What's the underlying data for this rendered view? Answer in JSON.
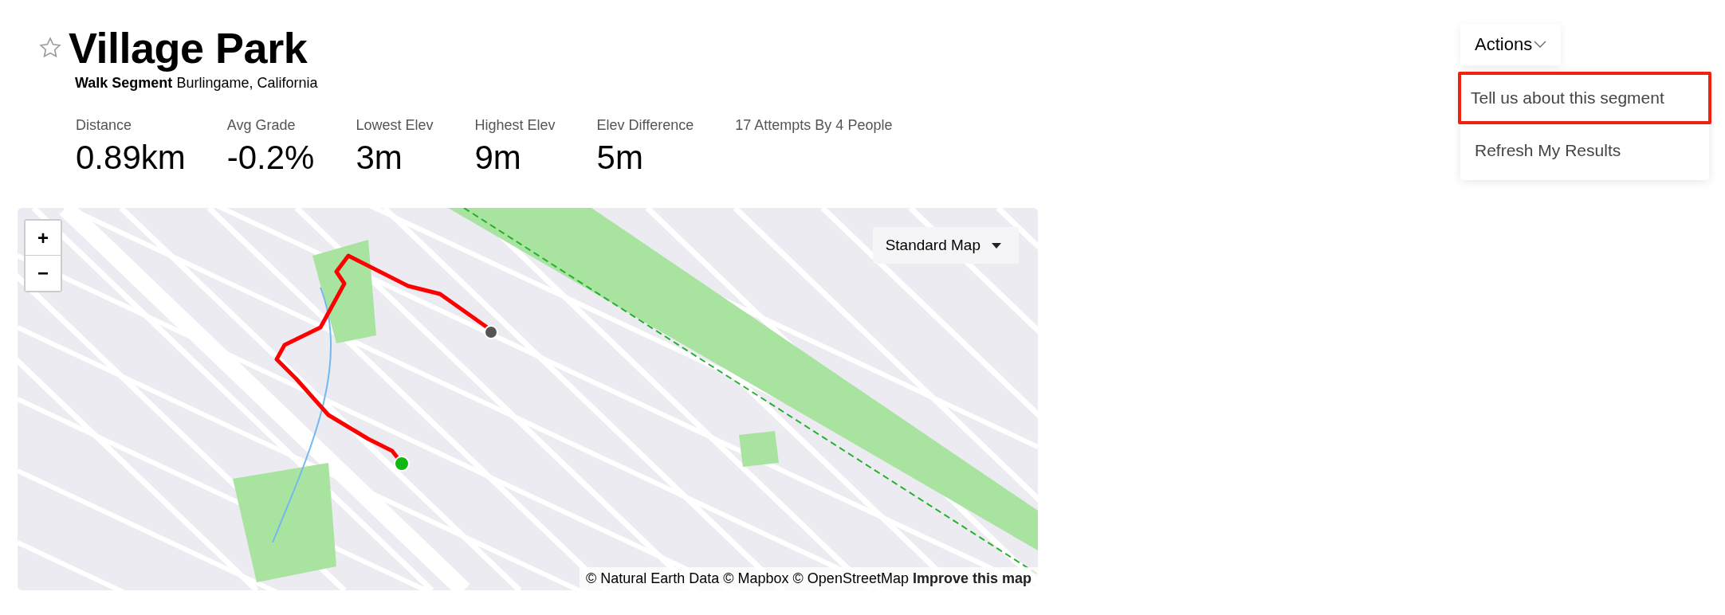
{
  "header": {
    "starred": false,
    "title": "Village Park",
    "subtitle": "**Walk Segment** Burlingame, California"
  },
  "stats": [
    {
      "label": "Distance",
      "value": "0.89km"
    },
    {
      "label": "Avg Grade",
      "value": "-0.2%"
    },
    {
      "label": "Lowest Elev",
      "value": "3m"
    },
    {
      "label": "Highest Elev",
      "value": "9m"
    },
    {
      "label": "Elev Difference",
      "value": "5m"
    },
    {
      "label": "17 Attempts By 4 People"
    }
  ],
  "map": {
    "kind": "picture",
    "zoom_in": "+",
    "zoom_out": "−",
    "style_select": "Standard Map",
    "attribution": "© Natural Earth Data © Mapbox © OpenStreetMap",
    "improve_link": "Improve this map"
  },
  "actions": {
    "label": "Actions",
    "expanded": true,
    "items": [
      {
        "label": "Tell us about this segment",
        "highlighted": true
      },
      {
        "label": "Refresh My Results",
        "highlighted": false
      }
    ]
  }
}
